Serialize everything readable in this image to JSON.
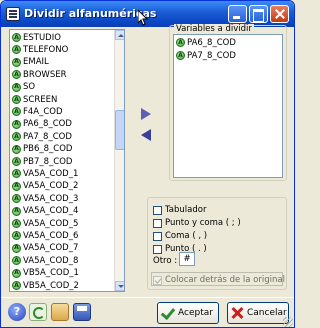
{
  "window": {
    "title": "Dividir alfanuméricas"
  },
  "source_variables": [
    "ESTUDIO",
    "TELEFONO",
    "EMAIL",
    "BROWSER",
    "SO",
    "SCREEN",
    "F4A_COD",
    "PA6_8_COD",
    "PA7_8_COD",
    "PB6_8_COD",
    "PB7_8_COD",
    "VA5A_COD_1",
    "VA5A_COD_2",
    "VA5A_COD_3",
    "VA5A_COD_4",
    "VA5A_COD_5",
    "VA5A_COD_6",
    "VA5A_COD_7",
    "VA5A_COD_8",
    "VB5A_COD_1",
    "VB5A_COD_2"
  ],
  "variable_badge": "A",
  "target": {
    "legend": "Variables a dividir",
    "items": [
      "PA6_8_COD",
      "PA7_8_COD"
    ]
  },
  "options": {
    "tab": "Tabulador",
    "semicolon": "Punto y coma ( ; )",
    "comma": "Coma ( , )",
    "period": "Punto ( . )",
    "other_label": "Otro :",
    "other_value": "#",
    "place_after": "Colocar detrás de la original"
  },
  "buttons": {
    "help": "?",
    "accept": "Aceptar",
    "cancel": "Cancelar"
  }
}
